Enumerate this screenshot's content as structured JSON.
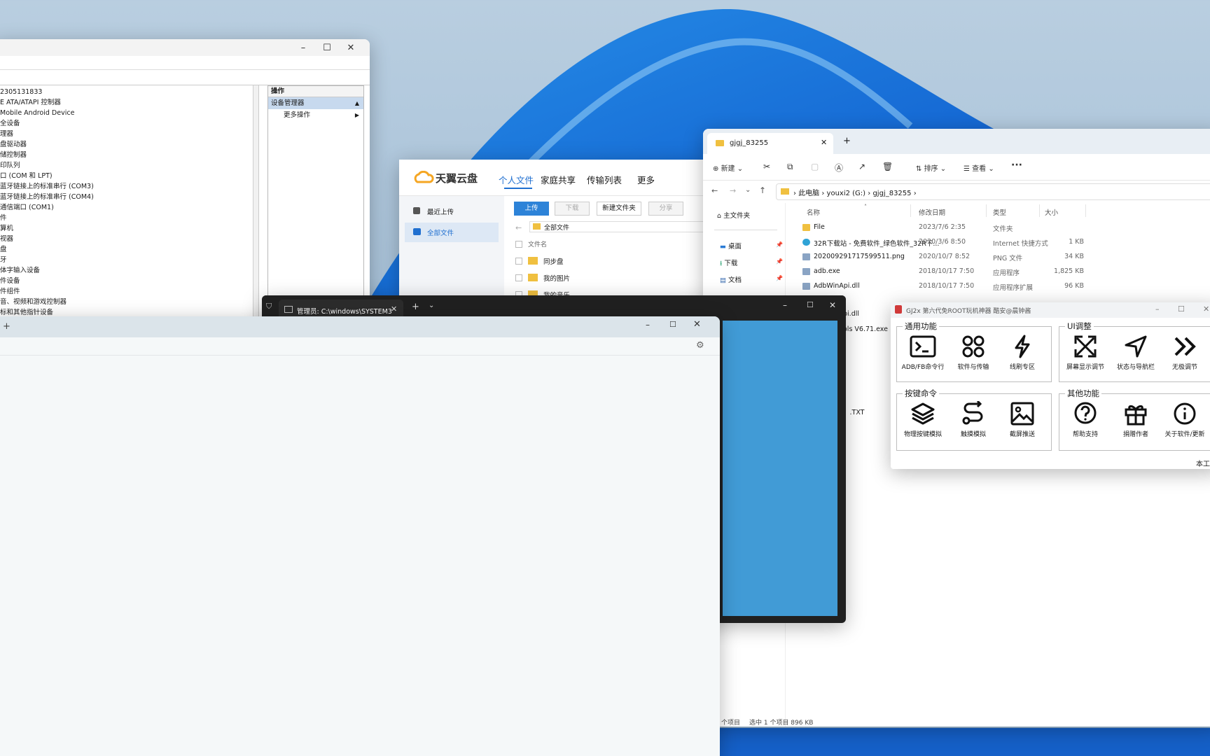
{
  "device_manager": {
    "tree_items": [
      "2305131833",
      "E ATA/ATAPI 控制器",
      "Mobile Android Device",
      "全设备",
      "理器",
      "盘驱动器",
      "储控制器",
      "印队列",
      "口 (COM 和 LPT)",
      "蓝牙链接上的标准串行 (COM3)",
      "蓝牙链接上的标准串行 (COM4)",
      "通信端口 (COM1)",
      "件",
      "算机",
      "视器",
      "盘",
      "牙",
      "体字输入设备",
      "件设备",
      "件组件",
      "音、视频和游戏控制器",
      "标和其他指针设备"
    ],
    "actions_header": "操作",
    "actions_selected": "设备管理器",
    "actions_more": "更多操作"
  },
  "cloud": {
    "brand": "天翼云盘",
    "nav": [
      "个人文件",
      "家庭共享",
      "传输列表",
      "更多"
    ],
    "side": [
      "最近上传",
      "全部文件"
    ],
    "buttons": [
      "上传",
      "下载",
      "新建文件夹",
      "分享"
    ],
    "path": "全部文件",
    "column": "文件名",
    "files": [
      "同步盘",
      "我的图片",
      "我的音乐"
    ]
  },
  "explorer": {
    "tab_title": "gjgj_83255",
    "toolbar": {
      "new": "新建",
      "sort": "排序",
      "view": "查看"
    },
    "breadcrumb": [
      "此电脑",
      "youxi2 (G:)",
      "gjgj_83255"
    ],
    "nav": [
      "主文件夹",
      "桌面",
      "下载",
      "文档"
    ],
    "columns": [
      "名称",
      "修改日期",
      "类型",
      "大小"
    ],
    "files": [
      {
        "name": "File",
        "date": "2023/7/6 2:35",
        "type": "文件夹",
        "size": ""
      },
      {
        "name": "32R下载站 - 免费软件_绿色软件_32R下...",
        "date": "2020/3/6 8:50",
        "type": "Internet 快捷方式",
        "size": "1 KB"
      },
      {
        "name": "202009291717599511.png",
        "date": "2020/10/7 8:52",
        "type": "PNG 文件",
        "size": "34 KB"
      },
      {
        "name": "adb.exe",
        "date": "2018/10/17 7:50",
        "type": "应用程序",
        "size": "1,825 KB"
      },
      {
        "name": "AdbWinApi.dll",
        "date": "2018/10/17 7:50",
        "type": "应用程序扩展",
        "size": "96 KB"
      }
    ],
    "partial_files": [
      "pi.dll",
      "ols V6.71.exe",
      "）.TXT"
    ],
    "status": {
      "count": "个项目",
      "selected": "选中 1 个项目  896 KB"
    }
  },
  "gj": {
    "title": "GJ2x 第六代免ROOT玩机神器 酷安@晨钟酱",
    "groups": [
      {
        "name": "通用功能",
        "items": [
          "ADB/FB命令行",
          "软件与传输",
          "线刷专区"
        ]
      },
      {
        "name": "UI调整",
        "items": [
          "屏幕显示调节",
          "状态与导航栏",
          "无极调节"
        ]
      },
      {
        "name": "按键命令",
        "items": [
          "物理按键模拟",
          "触摸模拟",
          "截屏推送"
        ]
      },
      {
        "name": "其他功能",
        "items": [
          "帮助支持",
          "捐赠作者",
          "关于软件/更新"
        ]
      }
    ],
    "footer": "本工"
  },
  "terminal": {
    "tab": "管理员: C:\\windows\\SYSTEM3",
    "accent": "#419bd6"
  },
  "colors": {
    "accent": "#1f6fd0",
    "folder": "#f0c040",
    "cloud_orange": "#f5a623"
  }
}
